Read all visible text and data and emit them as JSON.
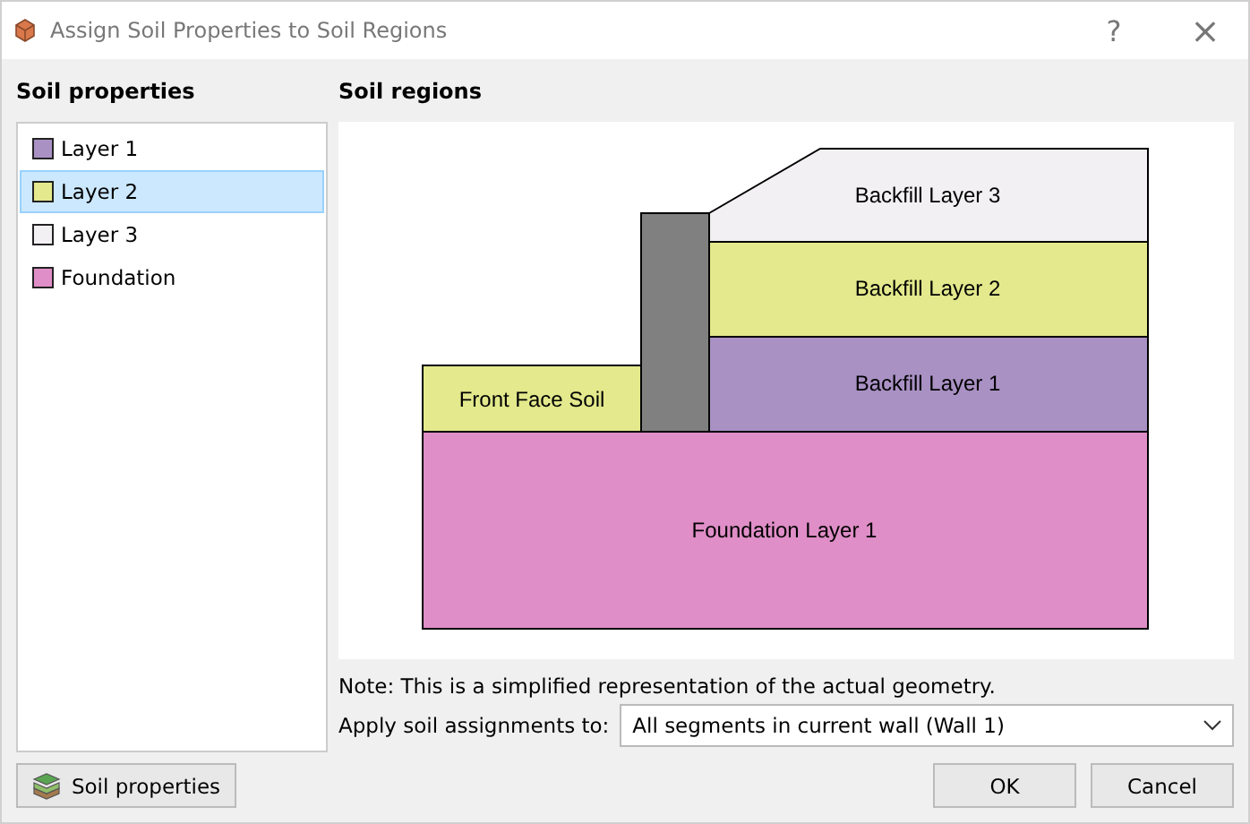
{
  "window": {
    "title": "Assign Soil Properties to Soil Regions",
    "help": "?",
    "close": "×"
  },
  "soil_properties": {
    "heading": "Soil properties",
    "items": [
      {
        "label": "Layer 1",
        "color": "#a991c4",
        "selected": false
      },
      {
        "label": "Layer 2",
        "color": "#e3e98c",
        "selected": true
      },
      {
        "label": "Layer 3",
        "color": "#f2f0f2",
        "selected": false
      },
      {
        "label": "Foundation",
        "color": "#df8ec7",
        "selected": false
      }
    ]
  },
  "soil_regions": {
    "heading": "Soil regions",
    "regions": [
      {
        "kind": "soil",
        "label": "Backfill Layer 3",
        "color": "#f2f0f2"
      },
      {
        "kind": "wall",
        "color": "#808080"
      },
      {
        "kind": "soil",
        "label": "Backfill Layer 2",
        "color": "#e3e98c"
      },
      {
        "kind": "soil",
        "label": "Backfill Layer 1",
        "color": "#a991c4"
      },
      {
        "kind": "soil",
        "label": "Front Face Soil",
        "color": "#e3e98c"
      },
      {
        "kind": "soil",
        "label": "Foundation Layer 1",
        "color": "#df8ec7"
      }
    ]
  },
  "note": "Note: This is a simplified representation of the actual geometry.",
  "apply": {
    "label": "Apply soil assignments to:",
    "value": "All segments in current wall (Wall 1)"
  },
  "buttons": {
    "soil_properties": "Soil properties",
    "ok": "OK",
    "cancel": "Cancel"
  }
}
